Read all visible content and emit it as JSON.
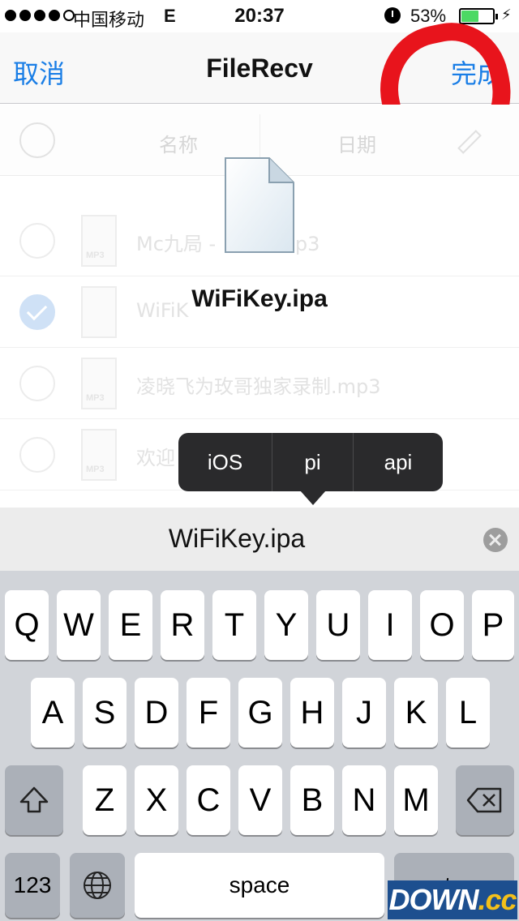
{
  "status_bar": {
    "carrier": "中国移动",
    "network": "E",
    "time": "20:37",
    "battery_pct": "53%",
    "battery_level": 0.53,
    "icons": [
      "signal-dots-icon",
      "alarm-icon",
      "battery-icon",
      "charging-bolt-icon"
    ]
  },
  "nav": {
    "cancel": "取消",
    "title": "FileRecv",
    "done": "完成"
  },
  "list": {
    "header_name": "名称",
    "header_date": "日期",
    "rows": [
      {
        "name": "Mc九局 - ",
        "suffix": "p3",
        "checked": false,
        "badge": "MP3"
      },
      {
        "name": "WiFiK",
        "suffix": "",
        "checked": true,
        "badge": ""
      },
      {
        "name": "凌晓飞为玫哥独家录制.mp3",
        "suffix": "",
        "checked": false,
        "badge": "MP3"
      },
      {
        "name": "欢迎",
        "suffix": "",
        "checked": false,
        "badge": "MP3"
      }
    ]
  },
  "drag": {
    "filename": "WiFiKey.ipa"
  },
  "suggestions": [
    "iOS",
    "pi",
    "api"
  ],
  "field": {
    "value": "WiFiKey.ipa"
  },
  "keyboard": {
    "row1": [
      "Q",
      "W",
      "E",
      "R",
      "T",
      "Y",
      "U",
      "I",
      "O",
      "P"
    ],
    "row2": [
      "A",
      "S",
      "D",
      "F",
      "G",
      "H",
      "J",
      "K",
      "L"
    ],
    "row3": [
      "Z",
      "X",
      "C",
      "V",
      "B",
      "N",
      "M"
    ],
    "numbers": "123",
    "space": "space",
    "return": "return"
  },
  "watermark": {
    "text": "DOWN",
    "suffix": ".cc"
  },
  "colors": {
    "accent": "#1a7ee6",
    "annotation": "#e8141c",
    "battery": "#4cd964"
  }
}
